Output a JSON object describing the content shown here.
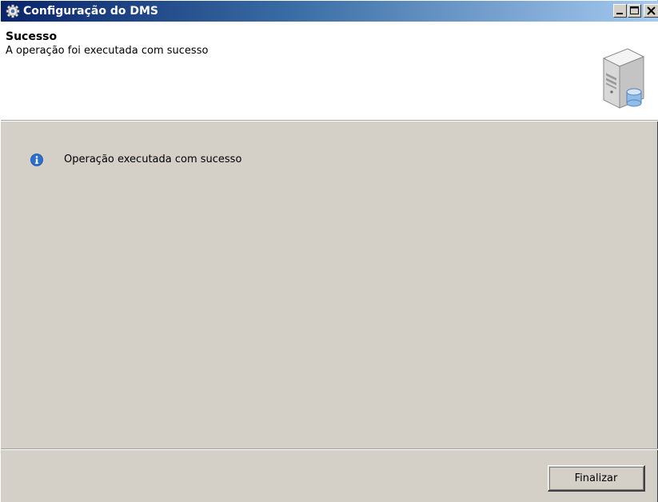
{
  "window": {
    "title": "Configuração do DMS",
    "title_icon": "gear-icon",
    "controls": {
      "minimize_icon": "minimize-icon",
      "maximize_icon": "maximize-icon",
      "close_icon": "close-icon"
    },
    "colors": {
      "titlebar_start": "#0a246a",
      "titlebar_end": "#a6caf0",
      "body": "#d4d0c8",
      "header": "#ffffff"
    }
  },
  "header": {
    "title": "Sucesso",
    "subtitle": "A operação foi executada com sucesso",
    "icon": "server-icon"
  },
  "message": {
    "icon": "info-icon",
    "text": "Operação executada com sucesso"
  },
  "footer": {
    "finish_label": "Finalizar"
  }
}
